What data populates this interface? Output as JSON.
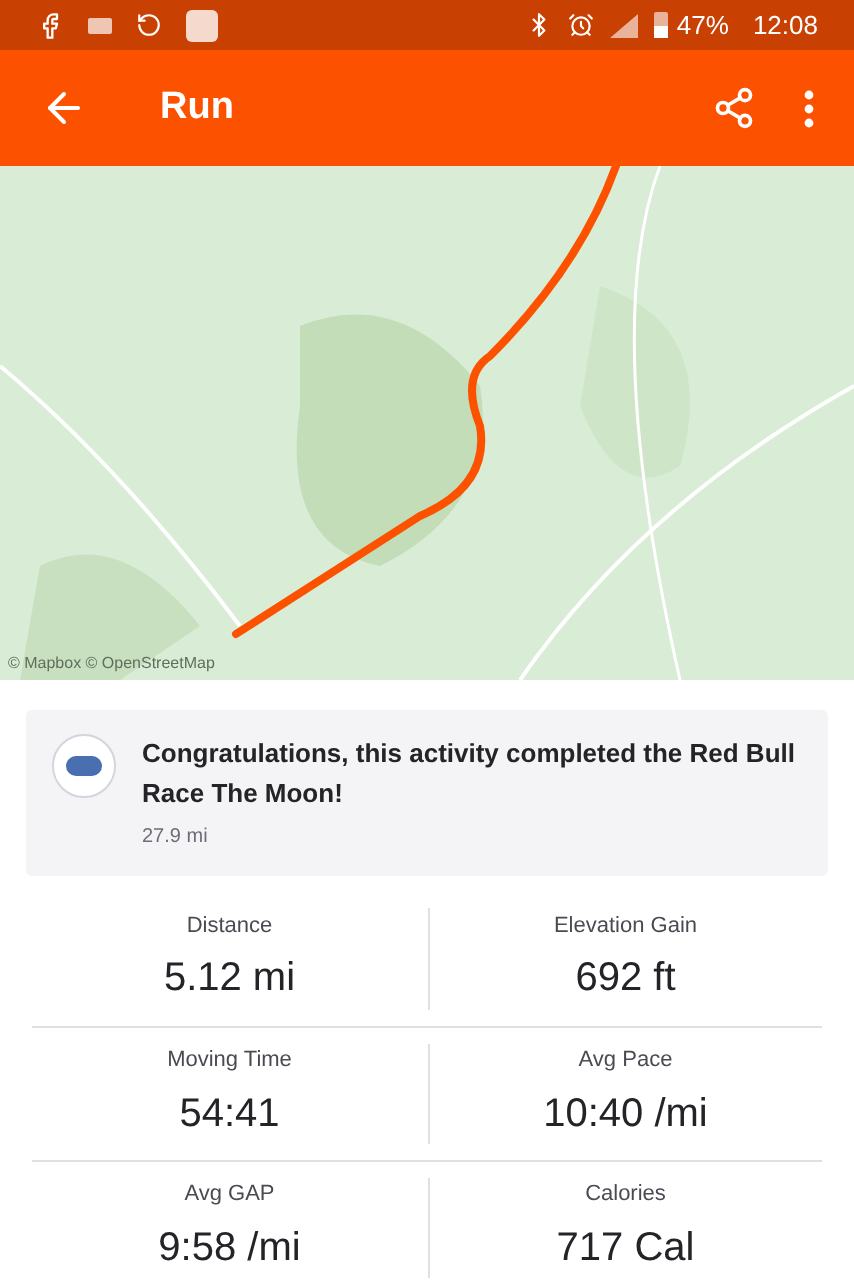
{
  "status_bar": {
    "battery": "47%",
    "time": "12:08"
  },
  "header": {
    "title": "Run"
  },
  "map": {
    "kind": "picture",
    "attribution": "© Mapbox © OpenStreetMap"
  },
  "challenge": {
    "message": "Congratulations, this activity completed the Red Bull Race The Moon!",
    "distance": "27.9 mi"
  },
  "stats": [
    {
      "label": "Distance",
      "value": "5.12 mi"
    },
    {
      "label": "Elevation Gain",
      "value": "692 ft"
    },
    {
      "label": "Moving Time",
      "value": "54:41"
    },
    {
      "label": "Avg Pace",
      "value": "10:40 /mi"
    },
    {
      "label": "Avg GAP",
      "value": "9:58 /mi"
    },
    {
      "label": "Calories",
      "value": "717 Cal"
    }
  ]
}
